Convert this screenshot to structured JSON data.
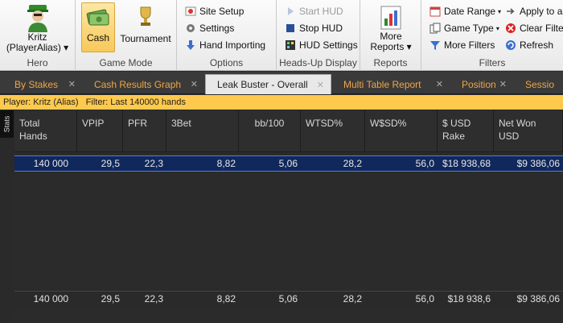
{
  "ribbon": {
    "hero": {
      "name_line1": "Kritz",
      "name_line2": "(PlayerAlias) ▾",
      "group_label": "Hero"
    },
    "game_mode": {
      "cash_label": "Cash",
      "tournament_label": "Tournament",
      "group_label": "Game Mode"
    },
    "options": {
      "site_setup": "Site Setup",
      "settings": "Settings",
      "hand_importing": "Hand Importing",
      "group_label": "Options"
    },
    "hud": {
      "start_hud": "Start HUD",
      "stop_hud": "Stop HUD",
      "hud_settings": "HUD Settings",
      "group_label": "Heads-Up Display"
    },
    "reports": {
      "more_reports_line1": "More",
      "more_reports_line2": "Reports ▾",
      "group_label": "Reports"
    },
    "filters": {
      "date_range": "Date Range",
      "game_type": "Game Type",
      "more_filters": "More Filters",
      "apply_to_all": "Apply to al",
      "clear_filters": "Clear Filter",
      "refresh": "Refresh",
      "group_label": "Filters"
    }
  },
  "tabs": [
    {
      "label": "By Stakes",
      "active": false
    },
    {
      "label": "Cash Results Graph",
      "active": false
    },
    {
      "label": "Leak Buster - Overall",
      "active": true
    },
    {
      "label": "Multi Table Report",
      "active": false
    },
    {
      "label": "Position",
      "active": false
    },
    {
      "label": "Sessio",
      "active": false
    }
  ],
  "filter_bar": {
    "text": "Player: Kritz (Alias)   Filter: Last 140000 hands"
  },
  "side_tab": "Stats",
  "table": {
    "headers": [
      {
        "line1": "Total",
        "line2": "Hands"
      },
      {
        "line1": "VPIP",
        "line2": ""
      },
      {
        "line1": "PFR",
        "line2": ""
      },
      {
        "line1": "3Bet",
        "line2": ""
      },
      {
        "line1": "bb/100",
        "line2": ""
      },
      {
        "line1": "WTSD%",
        "line2": ""
      },
      {
        "line1": "W$SD%",
        "line2": ""
      },
      {
        "line1": "$ USD",
        "line2": "Rake"
      },
      {
        "line1": "Net Won",
        "line2": "USD"
      }
    ],
    "rows": [
      [
        "140 000",
        "29,5",
        "22,3",
        "8,82",
        "5,06",
        "28,2",
        "56,0",
        "$18 938,68",
        "$9 386,06"
      ]
    ],
    "summary": [
      "140 000",
      "29,5",
      "22,3",
      "8,82",
      "5,06",
      "28,2",
      "56,0",
      "$18 938,6",
      "$9 386,06"
    ]
  },
  "colors": {
    "accent_tab_text": "#f0a545",
    "filter_bar": "#ffc94d",
    "selected_row": "#10285c",
    "positive_value": "#57ef63"
  }
}
